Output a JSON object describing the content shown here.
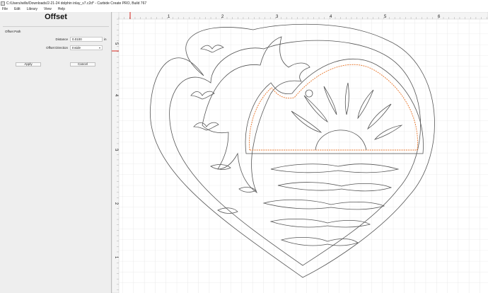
{
  "window": {
    "title": "C:/Users/willo/Downloads/2-21-24 dolphin inlay_v7.c2d* - Carbide Create PRO, Build 767"
  },
  "menu": {
    "items": [
      "File",
      "Edit",
      "Library",
      "View",
      "Help"
    ]
  },
  "panel": {
    "title": "Offset",
    "section_label": "Offset Path",
    "distance_label": "Distance",
    "distance_value": "0.0100",
    "distance_unit": "in",
    "direction_label": "Offset Direction",
    "direction_value": "Inside",
    "apply_label": "Apply",
    "cancel_label": "Cancel"
  },
  "ruler": {
    "top_ticks": [
      "1",
      "2",
      "3",
      "4",
      "5",
      "6"
    ],
    "left_ticks": [
      "5",
      "4",
      "3",
      "2",
      "1"
    ]
  },
  "colors": {
    "accent": "#e8762b",
    "grid": "#dcdcdc",
    "outline": "#555555",
    "marker": "#d9251c"
  }
}
